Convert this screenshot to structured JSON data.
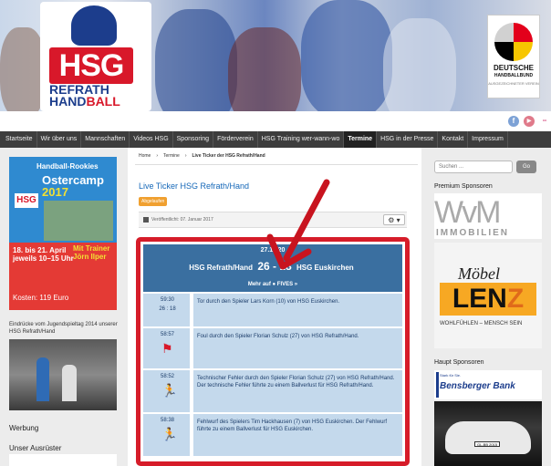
{
  "header": {
    "logo_hsg": "HSG",
    "logo_refrath": "REFRATH",
    "logo_hand": "HAND",
    "logo_ball": "BALL",
    "dhb_title_1": "DEUTSCHE",
    "dhb_title_2": "HANDBALLBUND",
    "dhb_sub": "AUSGEZEICHNETER VEREIN"
  },
  "social": {
    "facebook": "f",
    "youtube": "▶",
    "flickr": "••"
  },
  "nav": {
    "items": [
      "Startseite",
      "Wir über uns",
      "Mannschaften",
      "Videos HSG",
      "Sponsoring",
      "Förderverein",
      "HSG Training wer-wann-wo",
      "Termine",
      "HSG in der Presse",
      "Kontakt",
      "Impressum"
    ],
    "active": "Termine"
  },
  "left_sidebar": {
    "camp": {
      "headline": "Handball-Rookies",
      "title_1": "Ostercamp",
      "title_2": "2017",
      "logo": "HSG",
      "dates": "18. bis 21. April\njeweils 10–15 Uhr",
      "trainer": "Mit Trainer\nJörn Ilper",
      "cost": "Kosten: 119 Euro"
    },
    "impressions_text": "Eindrücke vom Jugendspieltag 2014 unserer HSG Refrath/Hand",
    "werbung": "Werbung",
    "ausruester": "Unser Ausrüster"
  },
  "breadcrumb": {
    "home": "Home",
    "termine": "Termine",
    "current": "Live Ticker der HSG Refrath/Hand"
  },
  "article": {
    "title": "Live Ticker HSG Refrath/Hand",
    "badge": "Abgelaufen",
    "date": "Veröffentlicht: 07. Januar 2017",
    "gear": "⚙ ▾"
  },
  "ticker": {
    "date": "27.11.20",
    "home_team": "HSG Refrath/Hand",
    "score": "26 - 18",
    "away_team": "HSG Euskirchen",
    "more": "Mehr auf ● FIVES »",
    "rows": [
      {
        "time": "59:30",
        "score": "26 : 18",
        "text": "Tor durch den Spieler Lars Korn (10) von HSG Euskirchen."
      },
      {
        "time": "58:57",
        "text": "Foul durch den Spieler Florian Schulz (27) von HSG Refrath/Hand."
      },
      {
        "time": "58:52",
        "text": "Technischer Fehler durch den Spieler Florian Schulz (27) von HSG Refrath/Hand. Der technische Fehler führte zu einem Ballverlust für HSG Refrath/Hand."
      },
      {
        "time": "58:38",
        "text": "Fehlwurf des Spielers Tim Hackhausen (7) von HSG Euskirchen. Der Fehlwurf führte zu einem Ballverlust für HSG Euskirchen."
      }
    ]
  },
  "right_sidebar": {
    "search_placeholder": "Suchen ...",
    "search_button": "Go",
    "premium": "Premium Sponsoren",
    "wvm_1": "WvM",
    "wvm_2": "IMMOBILIEN",
    "moebel": "Möbel",
    "lenz_l": "LEN",
    "lenz_z": "Z",
    "lenz_tag": "WOHLFÜHLEN – MENSCH SEIN",
    "haupt": "Haupt Sponsoren",
    "bensberger_1": "Stark für Sie.",
    "bensberger_2": "Bensberger Bank",
    "plate": "GL-BB 2015"
  },
  "colors": {
    "brand_red": "#d61c29",
    "brand_blue": "#1c3d8c",
    "ticker_blue": "#3a6fa0",
    "row_blue": "#c4d9ec",
    "nav_dark": "#3d3d3d"
  }
}
